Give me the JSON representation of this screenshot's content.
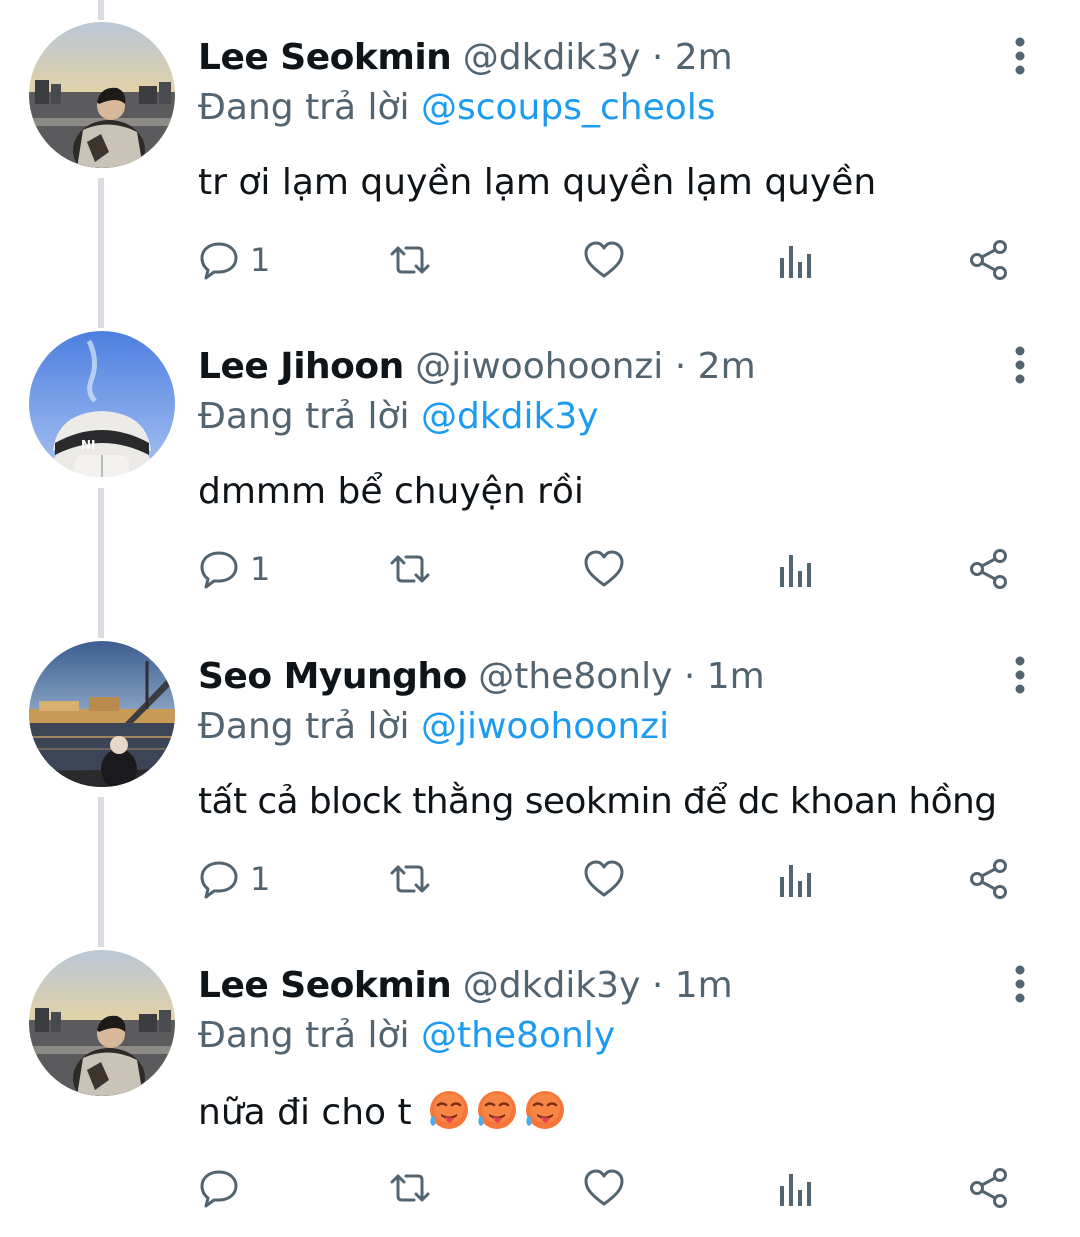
{
  "colors": {
    "text": "#0f1419",
    "secondary": "#536471",
    "link": "#1d9bf0",
    "thread_line": "#d9dde1"
  },
  "tweets": [
    {
      "name": "Lee Seokmin",
      "handle": "@dkdik3y",
      "separator": "·",
      "time": "2m",
      "reply_prefix": "Đang trả lời",
      "reply_to": "@scoups_cheols",
      "text": "tr ơi lạm quyền lạm quyền lạm quyền",
      "reply_count": "1",
      "avatar": "avatar-seokmin"
    },
    {
      "name": "Lee Jihoon",
      "handle": "@jiwoohoonzi",
      "separator": "·",
      "time": "2m",
      "reply_prefix": "Đang trả lời",
      "reply_to": "@dkdik3y",
      "text": "dmmm bể chuyện rồi",
      "reply_count": "1",
      "avatar": "avatar-jihoon"
    },
    {
      "name": "Seo Myungho",
      "handle": "@the8only",
      "separator": "·",
      "time": "1m",
      "reply_prefix": "Đang trả lời",
      "reply_to": "@jiwoohoonzi",
      "text": "tất cả block thằng seokmin để dc khoan hồng",
      "reply_count": "1",
      "avatar": "avatar-myungho"
    },
    {
      "name": "Lee Seokmin",
      "handle": "@dkdik3y",
      "separator": "·",
      "time": "1m",
      "reply_prefix": "Đang trả lời",
      "reply_to": "@the8only",
      "text": "nữa đi cho t",
      "reply_count": "",
      "avatar": "avatar-seokmin",
      "emojis": [
        "hot-face-emoji",
        "hot-face-emoji",
        "hot-face-emoji"
      ]
    }
  ],
  "icons": {
    "reply": "reply-bubble-icon",
    "retweet": "retweet-icon",
    "like": "heart-icon",
    "views": "analytics-icon",
    "share": "share-icon",
    "more": "more-vertical-icon"
  }
}
